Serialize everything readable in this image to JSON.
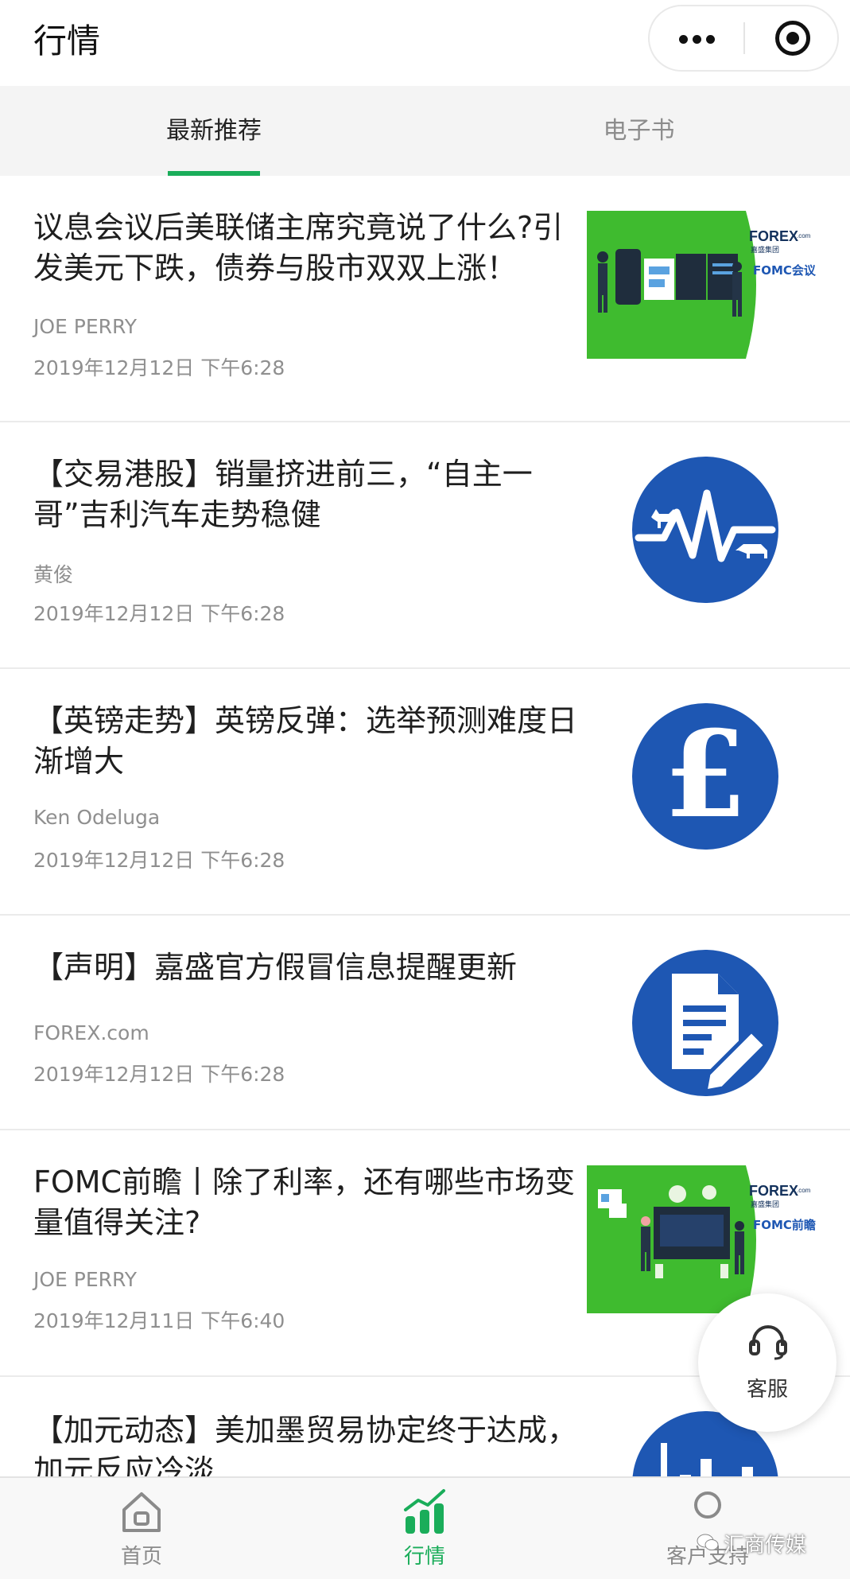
{
  "header": {
    "title": "行情"
  },
  "tabs": [
    {
      "label": "最新推荐",
      "active": true
    },
    {
      "label": "电子书",
      "active": false
    }
  ],
  "articles": [
    {
      "title": "议息会议后美联储主席究竟说了什么?引发美元下跌，债券与股市双双上涨！",
      "author": "JOE PERRY",
      "date": "2019年12月12日 下午6:28",
      "thumb": {
        "type": "banner",
        "brand": "FOREX",
        "brand_suffix": ".com",
        "brand_sub": "嘉盛集团",
        "caption": "FOMC会议"
      }
    },
    {
      "title": "【交易港股】销量挤进前三，“自主一哥”吉利汽车走势稳健",
      "author": "黄俊",
      "date": "2019年12月12日 下午6:28",
      "thumb": {
        "type": "circle",
        "icon": "bull-bear-pulse-icon"
      }
    },
    {
      "title": "【英镑走势】英镑反弹：选举预测难度日渐增大",
      "author": "Ken Odeluga",
      "date": "2019年12月12日 下午6:28",
      "thumb": {
        "type": "circle",
        "icon": "pound-sign-icon",
        "glyph": "£"
      }
    },
    {
      "title": "【声明】嘉盛官方假冒信息提醒更新",
      "author": "FOREX.com",
      "date": "2019年12月12日 下午6:28",
      "thumb": {
        "type": "circle",
        "icon": "document-pencil-icon"
      }
    },
    {
      "title": "FOMC前瞻丨除了利率，还有哪些市场变量值得关注?",
      "author": "JOE PERRY",
      "date": "2019年12月11日 下午6:40",
      "thumb": {
        "type": "banner",
        "brand": "FOREX",
        "brand_suffix": ".com",
        "brand_sub": "嘉盛集团",
        "caption": "FOMC前瞻"
      }
    },
    {
      "title": "【加元动态】美加墨贸易协定终于达成，加元反应冷淡",
      "thumb": {
        "type": "circle",
        "icon": "bar-chart-icon"
      }
    }
  ],
  "fab": {
    "label": "客服",
    "icon": "headset-icon"
  },
  "bottom_nav": [
    {
      "label": "首页",
      "icon": "home-icon",
      "active": false
    },
    {
      "label": "行情",
      "icon": "market-chart-icon",
      "active": true
    },
    {
      "label": "客户支持",
      "icon": "support-icon",
      "active": false
    }
  ],
  "watermark": {
    "text": "汇商传媒"
  },
  "colors": {
    "accent_green": "#1aad5a",
    "thumb_blue": "#1e57b3",
    "banner_green": "#3fbb2f",
    "brand_navy": "#13315c"
  }
}
